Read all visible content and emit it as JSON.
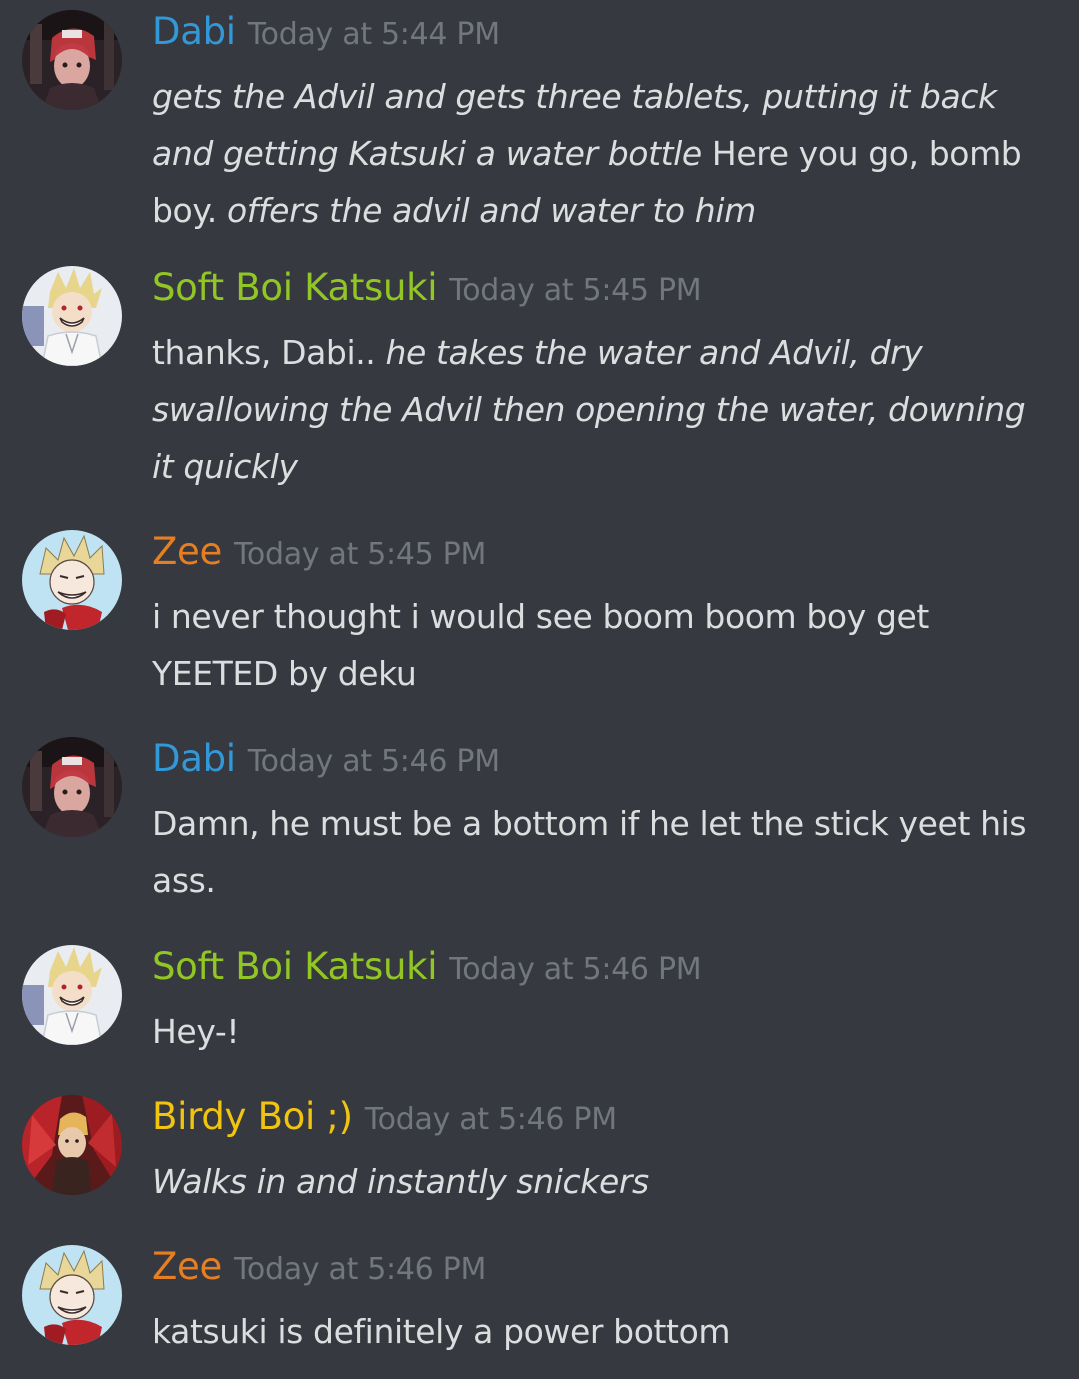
{
  "channel": {
    "messages": [
      {
        "username": "Dabi",
        "name_color": "#3298d8",
        "timestamp": "Today at 5:44 PM",
        "avatar_icon": "dabi-avatar-icon",
        "parts": [
          {
            "italic": true,
            "text": "gets the Advil and gets three tablets, putting it back and getting Katsuki a water bottle"
          },
          {
            "italic": false,
            "text": " Here you go, bomb boy. "
          },
          {
            "italic": true,
            "text": "offers the advil and water to him"
          }
        ]
      },
      {
        "username": "Soft Boi Katsuki",
        "name_color": "#91c624",
        "timestamp": "Today at 5:45 PM",
        "avatar_icon": "katsuki-avatar-icon",
        "parts": [
          {
            "italic": false,
            "text": "thanks, Dabi.. "
          },
          {
            "italic": true,
            "text": "he takes the water and Advil, dry swallowing the Advil then opening the water, downing it quickly"
          }
        ]
      },
      {
        "username": "Zee",
        "name_color": "#e67e22",
        "timestamp": "Today at 5:45 PM",
        "avatar_icon": "zee-avatar-icon",
        "parts": [
          {
            "italic": false,
            "text": "i never thought i would see boom boom boy get YEETED by deku"
          }
        ]
      },
      {
        "username": "Dabi",
        "name_color": "#3298d8",
        "timestamp": "Today at 5:46 PM",
        "avatar_icon": "dabi-avatar-icon",
        "parts": [
          {
            "italic": false,
            "text": "Damn, he must be a bottom if he let the stick yeet his ass."
          }
        ]
      },
      {
        "username": "Soft Boi Katsuki",
        "name_color": "#91c624",
        "timestamp": "Today at 5:46 PM",
        "avatar_icon": "katsuki-avatar-icon",
        "parts": [
          {
            "italic": false,
            "text": "Hey-!"
          }
        ]
      },
      {
        "username": "Birdy Boi ;)",
        "name_color": "#f1c40f",
        "timestamp": "Today at 5:46 PM",
        "avatar_icon": "birdy-avatar-icon",
        "parts": [
          {
            "italic": true,
            "text": "Walks in and instantly snickers"
          }
        ]
      },
      {
        "username": "Zee",
        "name_color": "#e67e22",
        "timestamp": "Today at 5:46 PM",
        "avatar_icon": "zee-avatar-icon",
        "parts": [
          {
            "italic": false,
            "text": "katsuki is definitely a power bottom"
          }
        ]
      }
    ]
  },
  "colors": {
    "background": "#36393f",
    "text": "#dcddde",
    "timestamp": "#72767d"
  }
}
